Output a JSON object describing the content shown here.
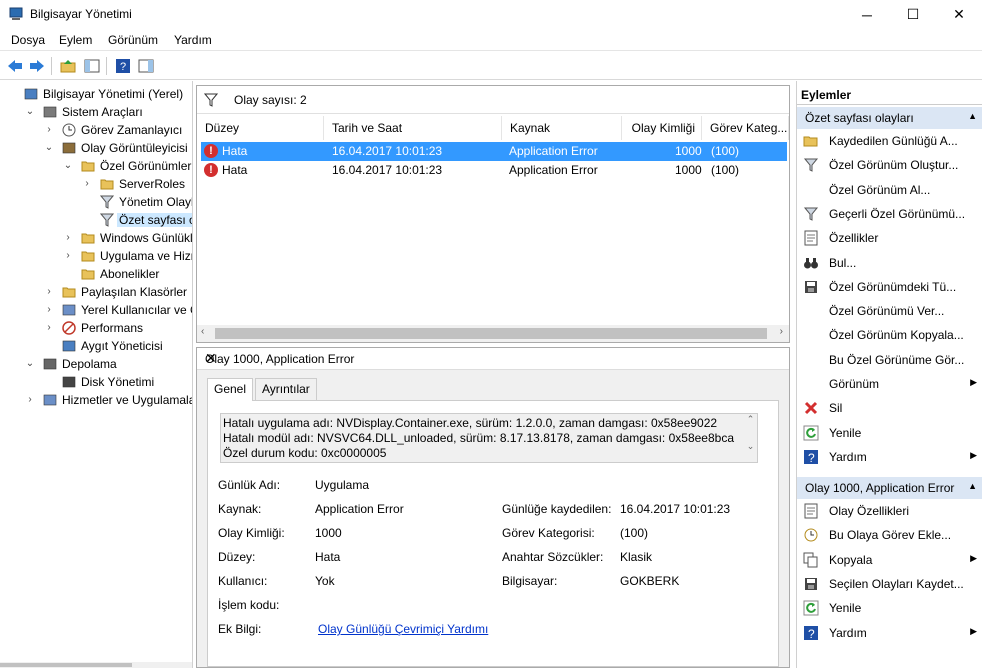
{
  "window": {
    "title": "Bilgisayar Yönetimi",
    "minimize": "─",
    "maximize": "☐",
    "close": "✕"
  },
  "menu": [
    "Dosya",
    "Eylem",
    "Görünüm",
    "Yardım"
  ],
  "tree": [
    {
      "label": "Bilgisayar Yönetimi (Yerel)",
      "icon": "computer-mgmt-icon"
    },
    {
      "label": "Sistem Araçları",
      "icon": "tools-icon",
      "expander": "⌄"
    },
    {
      "label": "Görev Zamanlayıcı",
      "icon": "clock-icon",
      "expander": "›"
    },
    {
      "label": "Olay Görüntüleyicisi",
      "icon": "event-viewer-icon",
      "expander": "⌄"
    },
    {
      "label": "Özel Görünümler",
      "icon": "folder-icon",
      "expander": "⌄"
    },
    {
      "label": "ServerRoles",
      "icon": "folder-icon",
      "expander": "›"
    },
    {
      "label": "Yönetim Olayları",
      "icon": "filter-icon"
    },
    {
      "label": "Özet sayfası olay",
      "icon": "filter-icon"
    },
    {
      "label": "Windows Günlükleri",
      "icon": "folder-icon",
      "expander": "›"
    },
    {
      "label": "Uygulama ve Hizme",
      "icon": "folder-icon",
      "expander": "›"
    },
    {
      "label": "Abonelikler",
      "icon": "subscriptions-icon"
    },
    {
      "label": "Paylaşılan Klasörler",
      "icon": "shared-folder-icon",
      "expander": "›"
    },
    {
      "label": "Yerel Kullanıcılar ve Gru",
      "icon": "users-icon",
      "expander": "›"
    },
    {
      "label": "Performans",
      "icon": "performance-icon",
      "expander": "›"
    },
    {
      "label": "Aygıt Yöneticisi",
      "icon": "device-manager-icon"
    },
    {
      "label": "Depolama",
      "icon": "storage-icon",
      "expander": "⌄"
    },
    {
      "label": "Disk Yönetimi",
      "icon": "disk-icon"
    },
    {
      "label": "Hizmetler ve Uygulamalar",
      "icon": "services-icon",
      "expander": "›"
    }
  ],
  "events": {
    "count_label": "Olay sayısı: 2",
    "columns": [
      "Düzey",
      "Tarih ve Saat",
      "Kaynak",
      "Olay Kimliği",
      "Görev Kateg..."
    ],
    "rows": [
      {
        "level": "Hata",
        "date": "16.04.2017 10:01:23",
        "source": "Application Error",
        "id": "1000",
        "task": "(100)"
      },
      {
        "level": "Hata",
        "date": "16.04.2017 10:01:23",
        "source": "Application Error",
        "id": "1000",
        "task": "(100)"
      }
    ]
  },
  "detail": {
    "title": "Olay 1000, Application Error",
    "close": "✕",
    "tabs": [
      "Genel",
      "Ayrıntılar"
    ],
    "message": [
      "Hatalı uygulama adı: NVDisplay.Container.exe, sürüm: 1.2.0.0, zaman damgası: 0x58ee9022",
      "Hatalı modül adı: NVSVC64.DLL_unloaded, sürüm: 8.17.13.8178, zaman damgası: 0x58ee8bca",
      "Özel durum kodu: 0xc0000005"
    ],
    "fields": {
      "log_name_label": "Günlük Adı:",
      "log_name": "Uygulama",
      "source_label": "Kaynak:",
      "source": "Application Error",
      "event_id_label": "Olay Kimliği:",
      "event_id": "1000",
      "level_label": "Düzey:",
      "level": "Hata",
      "user_label": "Kullanıcı:",
      "user": "Yok",
      "opcode_label": "İşlem kodu:",
      "more_info_label": "Ek Bilgi:",
      "more_info_link": "Olay Günlüğü Çevrimiçi Yardımı",
      "logged_label": "Günlüğe kaydedilen:",
      "logged": "16.04.2017 10:01:23",
      "task_label": "Görev Kategorisi:",
      "task": "(100)",
      "keywords_label": "Anahtar Sözcükler:",
      "keywords": "Klasik",
      "computer_label": "Bilgisayar:",
      "computer": "GOKBERK"
    }
  },
  "actions": {
    "header": "Eylemler",
    "section1": "Özet sayfası olayları",
    "items1": [
      {
        "label": "Kaydedilen Günlüğü A...",
        "icon": "open-folder-icon"
      },
      {
        "label": "Özel Görünüm Oluştur...",
        "icon": "filter-icon"
      },
      {
        "label": "Özel Görünüm Al...",
        "icon": ""
      },
      {
        "label": "Geçerli Özel Görünümü...",
        "icon": "filter-icon"
      },
      {
        "label": "Özellikler",
        "icon": "properties-icon"
      },
      {
        "label": "Bul...",
        "icon": "binoculars-icon"
      },
      {
        "label": "Özel Görünümdeki Tü...",
        "icon": "save-icon"
      },
      {
        "label": "Özel Görünümü Ver...",
        "icon": ""
      },
      {
        "label": "Özel Görünüm Kopyala...",
        "icon": ""
      },
      {
        "label": "Bu Özel Görünüme Gör...",
        "icon": ""
      },
      {
        "label": "Görünüm",
        "icon": "",
        "submenu": "▶"
      },
      {
        "label": "Sil",
        "icon": "delete-icon"
      },
      {
        "label": "Yenile",
        "icon": "refresh-icon"
      },
      {
        "label": "Yardım",
        "icon": "help-icon",
        "submenu": "▶"
      }
    ],
    "section2": "Olay 1000, Application Error",
    "items2": [
      {
        "label": "Olay Özellikleri",
        "icon": "properties-icon"
      },
      {
        "label": "Bu Olaya Görev Ekle...",
        "icon": "task-icon"
      },
      {
        "label": "Kopyala",
        "icon": "copy-icon",
        "submenu": "▶"
      },
      {
        "label": "Seçilen Olayları Kaydet...",
        "icon": "save-icon"
      },
      {
        "label": "Yenile",
        "icon": "refresh-icon"
      },
      {
        "label": "Yardım",
        "icon": "help-icon",
        "submenu": "▶"
      }
    ]
  }
}
